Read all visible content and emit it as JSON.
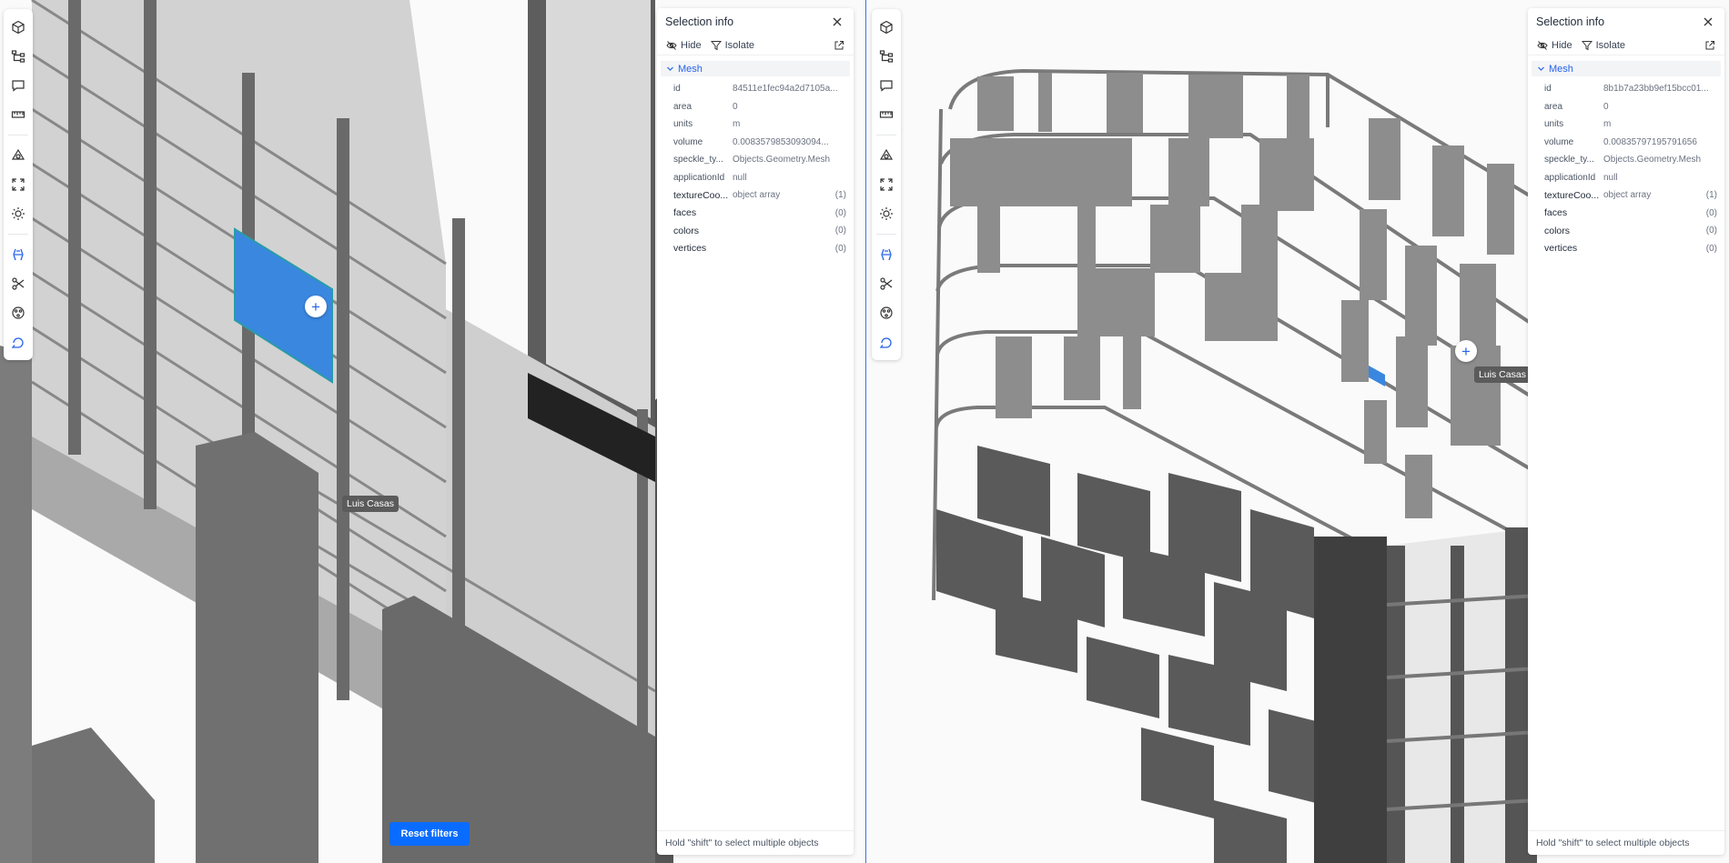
{
  "viewers": [
    {
      "panel": {
        "title": "Selection info",
        "actions": {
          "hide": "Hide",
          "isolate": "Isolate"
        },
        "group": "Mesh",
        "properties": [
          {
            "key": "id",
            "value": "84511e1fec94a2d7105a..."
          },
          {
            "key": "area",
            "value": "0"
          },
          {
            "key": "units",
            "value": "m"
          },
          {
            "key": "volume",
            "value": "0.0083579853093094..."
          },
          {
            "key": "speckle_ty...",
            "value": "Objects.Geometry.Mesh"
          },
          {
            "key": "applicationId",
            "value": "null"
          },
          {
            "key": "textureCoo...",
            "value": "object array",
            "count": "(1)"
          },
          {
            "key": "faces",
            "value": "",
            "count": "(0)"
          },
          {
            "key": "colors",
            "value": "",
            "count": "(0)"
          },
          {
            "key": "vertices",
            "value": "",
            "count": "(0)"
          }
        ],
        "footer": "Hold \"shift\" to select multiple objects"
      },
      "user_tag": "Luis Casas",
      "reset_button": "Reset filters"
    },
    {
      "panel": {
        "title": "Selection info",
        "actions": {
          "hide": "Hide",
          "isolate": "Isolate"
        },
        "group": "Mesh",
        "properties": [
          {
            "key": "id",
            "value": "8b1b7a23bb9ef15bcc01..."
          },
          {
            "key": "area",
            "value": "0"
          },
          {
            "key": "units",
            "value": "m"
          },
          {
            "key": "volume",
            "value": "0.00835797195791656"
          },
          {
            "key": "speckle_ty...",
            "value": "Objects.Geometry.Mesh"
          },
          {
            "key": "applicationId",
            "value": "null"
          },
          {
            "key": "textureCoo...",
            "value": "object array",
            "count": "(1)"
          },
          {
            "key": "faces",
            "value": "",
            "count": "(0)"
          },
          {
            "key": "colors",
            "value": "",
            "count": "(0)"
          },
          {
            "key": "vertices",
            "value": "",
            "count": "(0)"
          }
        ],
        "footer": "Hold \"shift\" to select multiple objects"
      },
      "user_tag": "Luis Casas"
    }
  ],
  "toolbar_icons": [
    "cube-icon",
    "model-tree-icon",
    "comments-icon",
    "measure-icon",
    "views-icon",
    "zoom-extents-icon",
    "sun-icon",
    "explode-icon",
    "section-cut-icon",
    "filters-icon",
    "discussions-icon"
  ],
  "colors": {
    "accent": "#2563eb",
    "selection": "#3a87e0",
    "reset": "#0a6cff"
  }
}
